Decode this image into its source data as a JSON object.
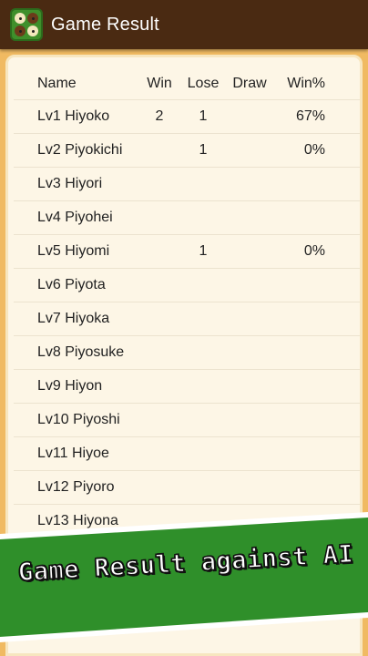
{
  "appbar": {
    "title": "Game Result",
    "icon": "othello-board-icon"
  },
  "table": {
    "headers": {
      "name": "Name",
      "win": "Win",
      "lose": "Lose",
      "draw": "Draw",
      "pct": "Win%"
    },
    "rows": [
      {
        "name": "Lv1 Hiyoko",
        "win": "2",
        "lose": "1",
        "draw": "",
        "pct": "67%"
      },
      {
        "name": "Lv2 Piyokichi",
        "win": "",
        "lose": "1",
        "draw": "",
        "pct": "0%"
      },
      {
        "name": "Lv3 Hiyori",
        "win": "",
        "lose": "",
        "draw": "",
        "pct": ""
      },
      {
        "name": "Lv4 Piyohei",
        "win": "",
        "lose": "",
        "draw": "",
        "pct": ""
      },
      {
        "name": "Lv5 Hiyomi",
        "win": "",
        "lose": "1",
        "draw": "",
        "pct": "0%"
      },
      {
        "name": "Lv6 Piyota",
        "win": "",
        "lose": "",
        "draw": "",
        "pct": ""
      },
      {
        "name": "Lv7 Hiyoka",
        "win": "",
        "lose": "",
        "draw": "",
        "pct": ""
      },
      {
        "name": "Lv8 Piyosuke",
        "win": "",
        "lose": "",
        "draw": "",
        "pct": ""
      },
      {
        "name": "Lv9 Hiyon",
        "win": "",
        "lose": "",
        "draw": "",
        "pct": ""
      },
      {
        "name": "Lv10 Piyoshi",
        "win": "",
        "lose": "",
        "draw": "",
        "pct": ""
      },
      {
        "name": "Lv11 Hiyoe",
        "win": "",
        "lose": "",
        "draw": "",
        "pct": ""
      },
      {
        "name": "Lv12 Piyoro",
        "win": "",
        "lose": "",
        "draw": "",
        "pct": ""
      },
      {
        "name": "Lv13 Hiyona",
        "win": "",
        "lose": "",
        "draw": "",
        "pct": ""
      }
    ]
  },
  "banner": {
    "text": "Game Result against AI"
  },
  "colors": {
    "appbar": "#4a2a12",
    "background": "#f0ba62",
    "panel": "#fdf6e6",
    "banner_green": "#2f8f2a",
    "banner_white": "#ffffff"
  }
}
